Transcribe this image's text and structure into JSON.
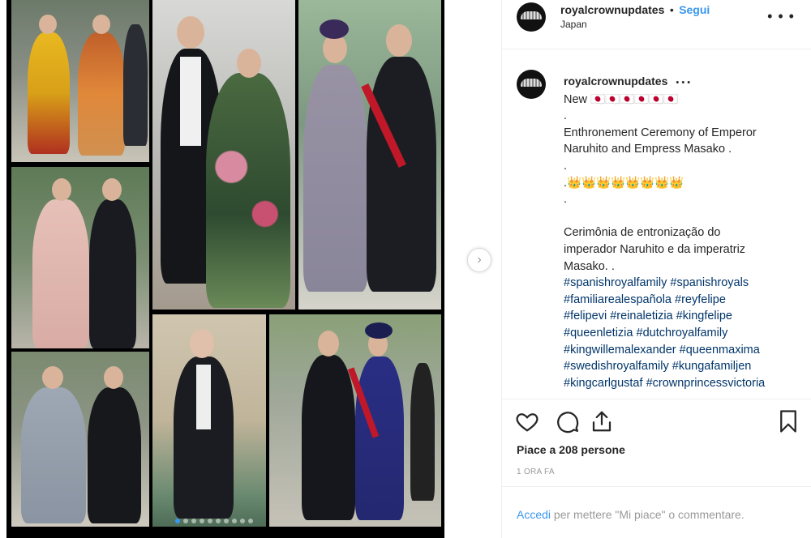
{
  "post": {
    "username": "royalcrownupdates",
    "separator": "•",
    "follow_label": "Segui",
    "location": "Japan",
    "more_icon": "more-horizontal-icon",
    "caption": {
      "username": "royalcrownupdates",
      "dots": "• • •",
      "line1": "New 🇯🇵🇯🇵🇯🇵🇯🇵🇯🇵🇯🇵",
      "line2": ".",
      "line3": "Enthronement Ceremony of Emperor",
      "line4": "Naruhito and Empress Masako .",
      "line5": ".",
      "crowns": ".👑👑👑👑👑👑👑👑",
      "line7": ".",
      "pt1": "Cerimônia de entronização do",
      "pt2": "imperador Naruhito e da imperatriz",
      "pt3": "Masako. .",
      "hashtag_lines": [
        [
          "#spanishroyalfamily",
          "#spanishroyals"
        ],
        [
          "#familiarealespañola",
          "#reyfelipe"
        ],
        [
          "#felipevi",
          "#reinaletizia",
          "#kingfelipe"
        ],
        [
          "#queenletizia",
          "#dutchroyalfamily"
        ],
        [
          "#kingwillemalexander",
          "#queenmaxima"
        ],
        [
          "#swedishroyalfamily",
          "#kungafamiljen"
        ],
        [
          "#kingcarlgustaf",
          "#crownprincessvictoria"
        ]
      ]
    },
    "likes_text": "Piace a 208 persone",
    "time_text": "1 ORA FA",
    "login": {
      "link": "Accedi",
      "rest": " per mettere \"Mi piace\" o commentare."
    }
  },
  "carousel": {
    "next_icon": "chevron-right-icon",
    "dot_count": 10,
    "active_dot": 0
  },
  "colors": {
    "link": "#3897f0",
    "hashtag": "#003569",
    "text": "#262626"
  }
}
